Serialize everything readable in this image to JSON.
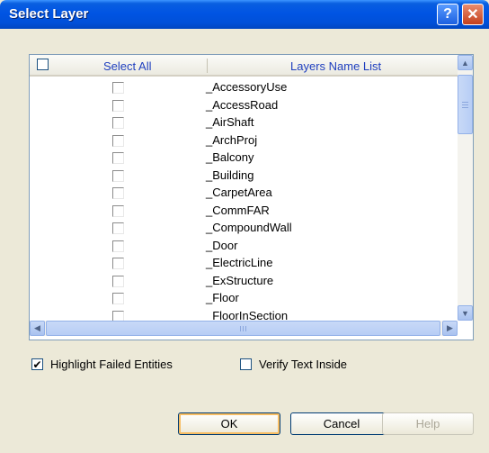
{
  "window": {
    "title": "Select Layer",
    "help_glyph": "?",
    "close_glyph": "✕"
  },
  "list": {
    "header_select_all": "Select All",
    "header_names": "Layers Name List",
    "items": [
      {
        "name": "_AccessoryUse",
        "checked": false
      },
      {
        "name": "_AccessRoad",
        "checked": false
      },
      {
        "name": "_AirShaft",
        "checked": false
      },
      {
        "name": "_ArchProj",
        "checked": false
      },
      {
        "name": "_Balcony",
        "checked": false
      },
      {
        "name": "_Building",
        "checked": false
      },
      {
        "name": "_CarpetArea",
        "checked": false
      },
      {
        "name": "_CommFAR",
        "checked": false
      },
      {
        "name": "_CompoundWall",
        "checked": false
      },
      {
        "name": "_Door",
        "checked": false
      },
      {
        "name": "_ElectricLine",
        "checked": false
      },
      {
        "name": "_ExStructure",
        "checked": false
      },
      {
        "name": "_Floor",
        "checked": false
      },
      {
        "name": "_FloorInSection",
        "checked": false
      }
    ]
  },
  "options": {
    "highlight_label": "Highlight Failed Entities",
    "highlight_checked": true,
    "verify_label": "Verify Text Inside",
    "verify_checked": false
  },
  "buttons": {
    "ok": "OK",
    "cancel": "Cancel",
    "help": "Help"
  },
  "colors": {
    "titlebar": "#0054e3",
    "header_text": "#1f3fbf",
    "disabled_text": "#aca899"
  }
}
